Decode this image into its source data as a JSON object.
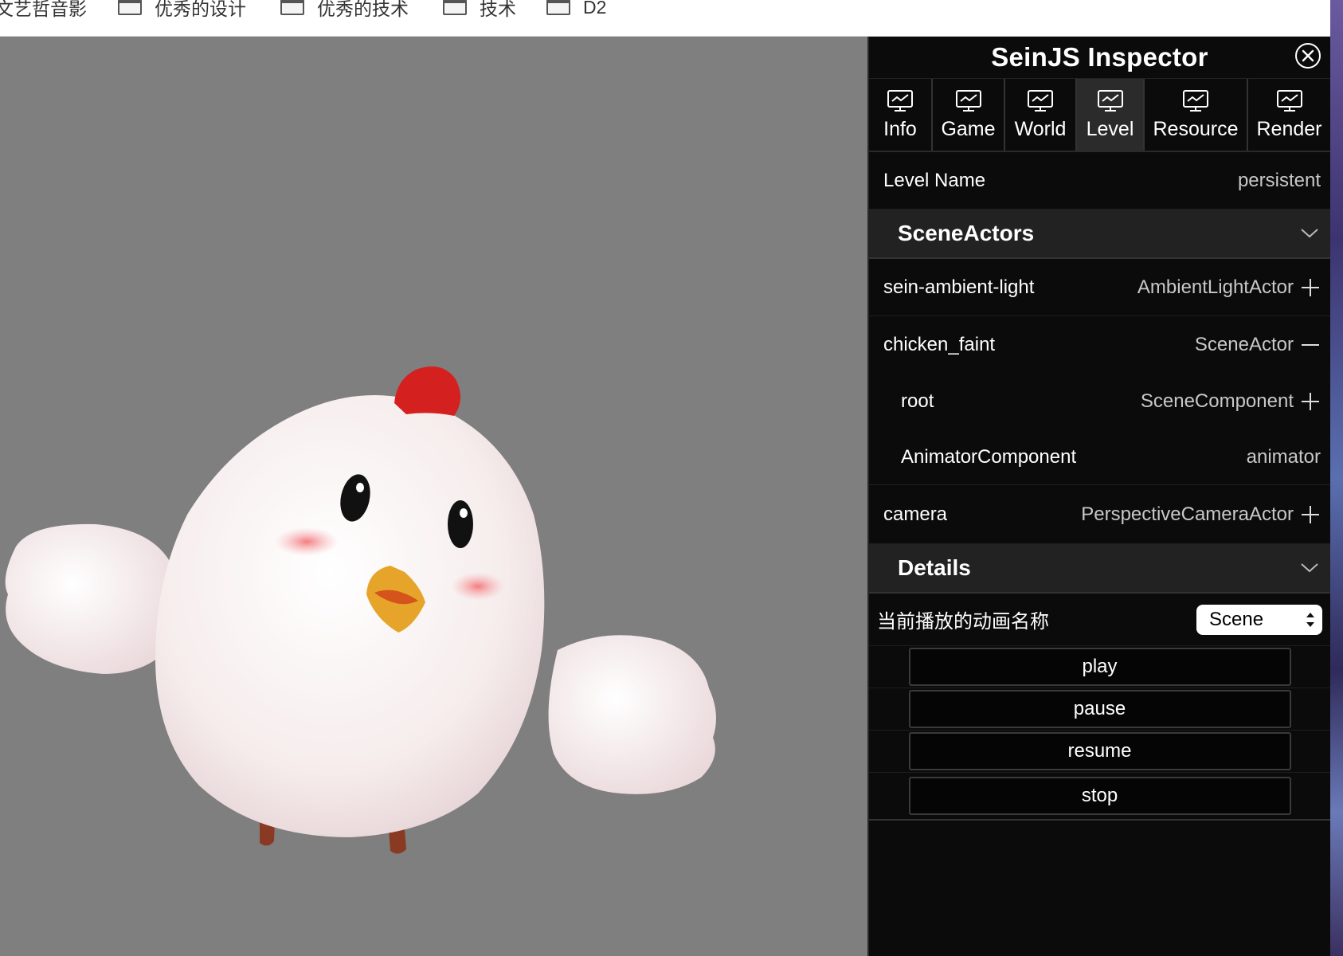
{
  "bookmarks": [
    {
      "label": "文艺哲音影"
    },
    {
      "label": "优秀的设计"
    },
    {
      "label": "优秀的技术"
    },
    {
      "label": "技术"
    },
    {
      "label": "D2"
    }
  ],
  "inspector": {
    "title": "SeinJS Inspector",
    "tabs": [
      {
        "label": "Info",
        "icon": "monitor-chart-icon"
      },
      {
        "label": "Game",
        "icon": "monitor-chart-icon"
      },
      {
        "label": "World",
        "icon": "monitor-chart-icon"
      },
      {
        "label": "Level",
        "icon": "monitor-chart-icon",
        "active": true
      },
      {
        "label": "Resource",
        "icon": "monitor-chart-icon"
      },
      {
        "label": "Render",
        "icon": "monitor-chart-icon"
      }
    ],
    "level": {
      "key": "Level Name",
      "value": "persistent"
    },
    "scene_actors": {
      "title": "SceneActors",
      "items": [
        {
          "name": "sein-ambient-light",
          "type": "AmbientLightActor",
          "toggle": "plus"
        },
        {
          "name": "chicken_faint",
          "type": "SceneActor",
          "toggle": "minus"
        },
        {
          "name": "root",
          "type": "SceneComponent",
          "toggle": "plus"
        },
        {
          "name": "AnimatorComponent",
          "type": "animator",
          "toggle": "none"
        },
        {
          "name": "camera",
          "type": "PerspectiveCameraActor",
          "toggle": "plus"
        }
      ]
    },
    "details": {
      "title": "Details",
      "animation_label": "当前播放的动画名称",
      "animation_select": "Scene",
      "buttons": [
        "play",
        "pause",
        "resume",
        "stop"
      ]
    }
  },
  "colors": {
    "viewport_bg": "#7f7f7f",
    "panel_bg": "#0b0b0b",
    "section_bg": "#222222",
    "active_tab_bg": "#2b2b2b"
  }
}
